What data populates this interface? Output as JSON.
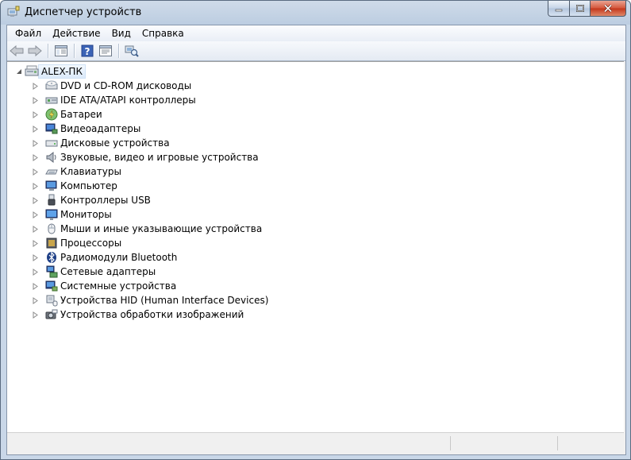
{
  "window": {
    "title": "Диспетчер устройств"
  },
  "colors": {
    "titlebar": "#bccde1",
    "close": "#c3351a",
    "selection": "#dceafa"
  },
  "menu": [
    {
      "label": "Файл"
    },
    {
      "label": "Действие"
    },
    {
      "label": "Вид"
    },
    {
      "label": "Справка"
    }
  ],
  "toolbar": {
    "buttons": [
      {
        "icon": "back-arrow-icon"
      },
      {
        "icon": "forward-arrow-icon"
      },
      {
        "icon": "show-hide-console-tree-icon"
      },
      {
        "icon": "help-icon"
      },
      {
        "icon": "properties-icon"
      },
      {
        "icon": "scan-hardware-icon"
      }
    ]
  },
  "tree": {
    "root": {
      "label": "ALEX-ПК",
      "icon": "computer-icon",
      "expanded": true
    },
    "items": [
      {
        "label": "DVD и CD-ROM дисководы",
        "icon": "dvd-drive-icon"
      },
      {
        "label": "IDE ATA/ATAPI контроллеры",
        "icon": "ide-controller-icon"
      },
      {
        "label": "Батареи",
        "icon": "battery-icon"
      },
      {
        "label": "Видеоадаптеры",
        "icon": "display-adapter-icon"
      },
      {
        "label": "Дисковые устройства",
        "icon": "disk-drive-icon"
      },
      {
        "label": "Звуковые, видео и игровые устройства",
        "icon": "speaker-icon"
      },
      {
        "label": "Клавиатуры",
        "icon": "keyboard-icon"
      },
      {
        "label": "Компьютер",
        "icon": "computer-icon"
      },
      {
        "label": "Контроллеры USB",
        "icon": "usb-icon"
      },
      {
        "label": "Мониторы",
        "icon": "monitor-icon"
      },
      {
        "label": "Мыши и иные указывающие устройства",
        "icon": "mouse-icon"
      },
      {
        "label": "Процессоры",
        "icon": "processor-icon"
      },
      {
        "label": "Радиомодули Bluetooth",
        "icon": "bluetooth-icon"
      },
      {
        "label": "Сетевые адаптеры",
        "icon": "network-adapter-icon"
      },
      {
        "label": "Системные устройства",
        "icon": "system-device-icon"
      },
      {
        "label": "Устройства HID (Human Interface Devices)",
        "icon": "hid-icon"
      },
      {
        "label": "Устройства обработки изображений",
        "icon": "imaging-device-icon"
      }
    ]
  },
  "statusbar": {
    "panes": [
      "",
      "",
      ""
    ]
  }
}
